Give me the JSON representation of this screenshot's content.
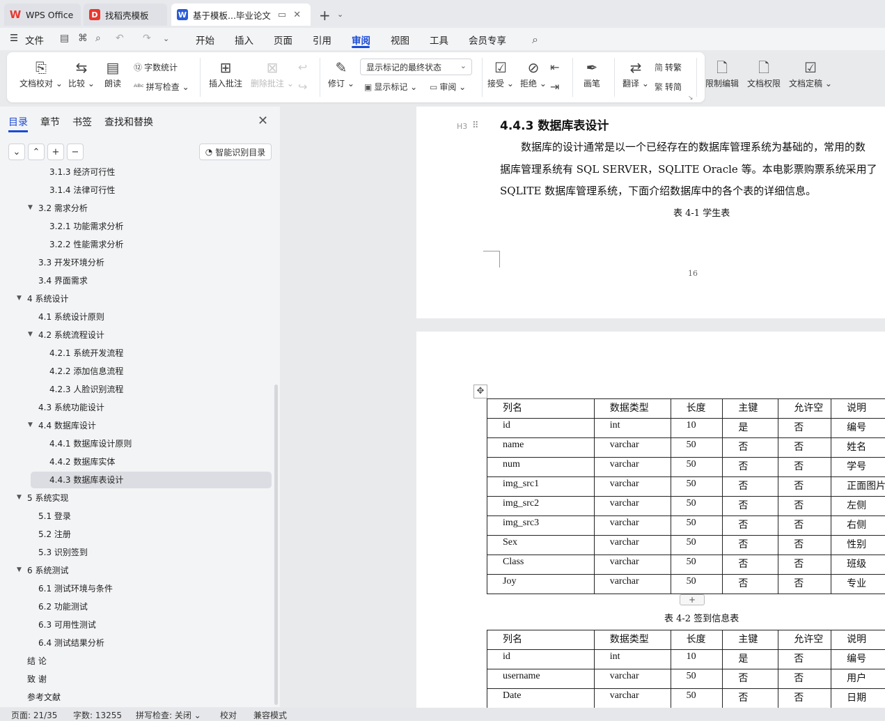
{
  "tabs": [
    {
      "label": "WPS Office"
    },
    {
      "label": "找稻壳模板"
    },
    {
      "label": "基于模板...毕业论文"
    }
  ],
  "menu": [
    "文件",
    "开始",
    "插入",
    "页面",
    "引用",
    "审阅",
    "视图",
    "工具",
    "会员专享"
  ],
  "ribbon": {
    "doc_check": "文档校对",
    "compare": "比较",
    "read": "朗读",
    "word_count": "字数统计",
    "spell_check": "拼写检查",
    "insert_comment": "插入批注",
    "delete_comment": "删除批注",
    "revise": "修订",
    "markup_state": "显示标记的最终状态",
    "show_markup": "显示标记",
    "review_pane": "审阅",
    "accept": "接受",
    "reject": "拒绝",
    "pen": "画笔",
    "translate": "翻译",
    "to_traditional": "转繁",
    "to_simplified": "转简",
    "restrict_edit": "限制编辑",
    "doc_permission": "文档权限",
    "finalize": "文档定稿"
  },
  "sidebar": {
    "tabs": [
      "目录",
      "章节",
      "书签",
      "查找和替换"
    ],
    "smart_toc": "智能识别目录",
    "toc": [
      {
        "label": "3.1.3  经济可行性"
      },
      {
        "label": "3.1.4  法律可行性"
      },
      {
        "label": "3.2 需求分析"
      },
      {
        "label": "3.2.1  功能需求分析"
      },
      {
        "label": "3.2.2  性能需求分析"
      },
      {
        "label": "3.3 开发环境分析"
      },
      {
        "label": "3.4 界面需求"
      },
      {
        "label": "4  系统设计"
      },
      {
        "label": "4.1 系统设计原则"
      },
      {
        "label": "4.2 系统流程设计"
      },
      {
        "label": "4.2.1 系统开发流程"
      },
      {
        "label": "4.2.2  添加信息流程"
      },
      {
        "label": "4.2.3  人脸识别流程"
      },
      {
        "label": "4.3  系统功能设计"
      },
      {
        "label": "4.4  数据库设计"
      },
      {
        "label": "4.4.1  数据库设计原则"
      },
      {
        "label": "4.4.2  数据库实体"
      },
      {
        "label": "4.4.3  数据库表设计"
      },
      {
        "label": "5 系统实现"
      },
      {
        "label": "5.1  登录"
      },
      {
        "label": "5.2  注册"
      },
      {
        "label": "5.3  识别签到"
      },
      {
        "label": "6 系统测试"
      },
      {
        "label": "6.1 测试环境与条件"
      },
      {
        "label": "6.2 功能测试"
      },
      {
        "label": "6.3 可用性测试"
      },
      {
        "label": "6.4 测试结果分析"
      },
      {
        "label": "结      论"
      },
      {
        "label": "致      谢"
      },
      {
        "label": "参考文献"
      }
    ]
  },
  "document": {
    "heading_marker": "H3",
    "heading": "4.4.3  数据库表设计",
    "para_lines": [
      "数据库的设计通常是以一个已经存在的数据库管理系统为基础的，常用的数",
      "据库管理系统有 SQL SERVER，SQLITE Oracle 等。本电影票购票系统采用了",
      "SQLITE 数据库管理系统，下面介绍数据库中的各个表的详细信息。"
    ],
    "table1_caption": "表 4-1  学生表",
    "page_number": "16",
    "table1": {
      "headers": [
        "列名",
        "数据类型",
        "长度",
        "主键",
        "允许空",
        "说明"
      ],
      "rows": [
        [
          "id",
          "int",
          "10",
          "是",
          "否",
          "编号"
        ],
        [
          "name",
          "varchar",
          "50",
          "否",
          "否",
          "姓名"
        ],
        [
          "num",
          "varchar",
          "50",
          "否",
          "否",
          "学号"
        ],
        [
          "img_src1",
          "varchar",
          "50",
          "否",
          "否",
          "正面图片"
        ],
        [
          "img_src2",
          "varchar",
          "50",
          "否",
          "否",
          "左侧"
        ],
        [
          "img_src3",
          "varchar",
          "50",
          "否",
          "否",
          "右侧"
        ],
        [
          "Sex",
          "varchar",
          "50",
          "否",
          "否",
          "性别"
        ],
        [
          "Class",
          "varchar",
          "50",
          "否",
          "否",
          "班级"
        ],
        [
          "Joy",
          "varchar",
          "50",
          "否",
          "否",
          "专业"
        ]
      ]
    },
    "table2_caption": "表 4-2  签到信息表",
    "table2": {
      "headers": [
        "列名",
        "数据类型",
        "长度",
        "主键",
        "允许空",
        "说明"
      ],
      "rows": [
        [
          "id",
          "int",
          "10",
          "是",
          "否",
          "编号"
        ],
        [
          "username",
          "varchar",
          "50",
          "否",
          "否",
          "用户"
        ],
        [
          "Date",
          "varchar",
          "50",
          "否",
          "否",
          "日期"
        ]
      ]
    }
  },
  "status": {
    "page": "页面: 21/35",
    "words": "字数: 13255",
    "spell": "拼写检查: 关闭",
    "proof": "校对",
    "compat": "兼容模式"
  },
  "colors": {
    "accent": "#1a4bd6",
    "wps_red": "#e8382f"
  }
}
